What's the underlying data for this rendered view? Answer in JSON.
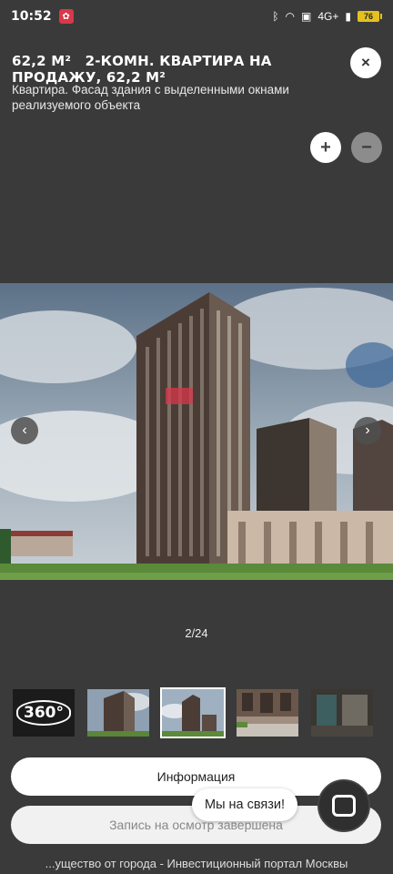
{
  "status_bar": {
    "time": "10:52",
    "network": "4G+",
    "battery": "76"
  },
  "header": {
    "area": "62,2 М²",
    "title": "2-КОМН. КВАРТИРА НА ПРОДАЖУ, 62,2 М²",
    "caption": "Квартира. Фасад здания с выделенными окнами реализуемого объекта"
  },
  "controls": {
    "close": "×",
    "zoom_in": "+",
    "zoom_out": "−",
    "prev": "‹",
    "next": "›"
  },
  "gallery": {
    "counter": "2/24",
    "thumb_360_label": "360°"
  },
  "buttons": {
    "info": "Информация",
    "visit": "Запись на осмотр завершена"
  },
  "chat": {
    "bubble": "Мы на связи!"
  },
  "footer": {
    "text": "...ущество от города - Инвестиционный портал Москвы"
  },
  "colors": {
    "background": "#3a3a3a",
    "highlight": "#d8384a",
    "battery": "#e3c21f"
  }
}
